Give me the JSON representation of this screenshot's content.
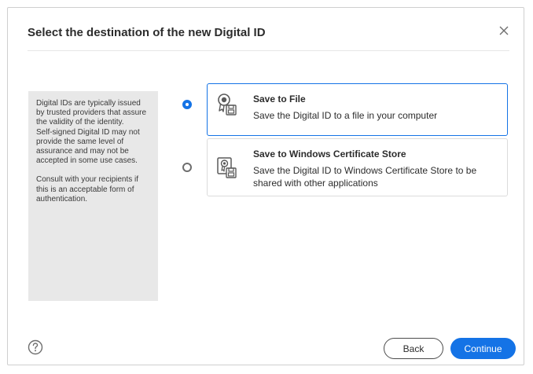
{
  "dialog": {
    "title": "Select the destination of the new Digital ID",
    "close_icon": "close-icon",
    "help_icon": "help-icon"
  },
  "info_panel": {
    "paragraph1": "Digital IDs are typically issued by trusted providers that assure the validity of the identity.",
    "paragraph2": "Self-signed Digital ID may not provide the same level of assurance and may not be accepted in some use cases.",
    "paragraph3": "Consult with your recipients if this is an acceptable form of authentication."
  },
  "options": [
    {
      "title": "Save to File",
      "description": "Save the Digital ID to a file in your computer",
      "icon": "certificate-file-icon",
      "selected": true
    },
    {
      "title": "Save to Windows Certificate Store",
      "description": "Save the Digital ID to Windows Certificate Store to be shared with other applications",
      "icon": "certificate-store-icon",
      "selected": false
    }
  ],
  "buttons": {
    "back": "Back",
    "continue": "Continue"
  },
  "colors": {
    "accent": "#1473e6",
    "panel_bg": "#e8e8e8"
  }
}
